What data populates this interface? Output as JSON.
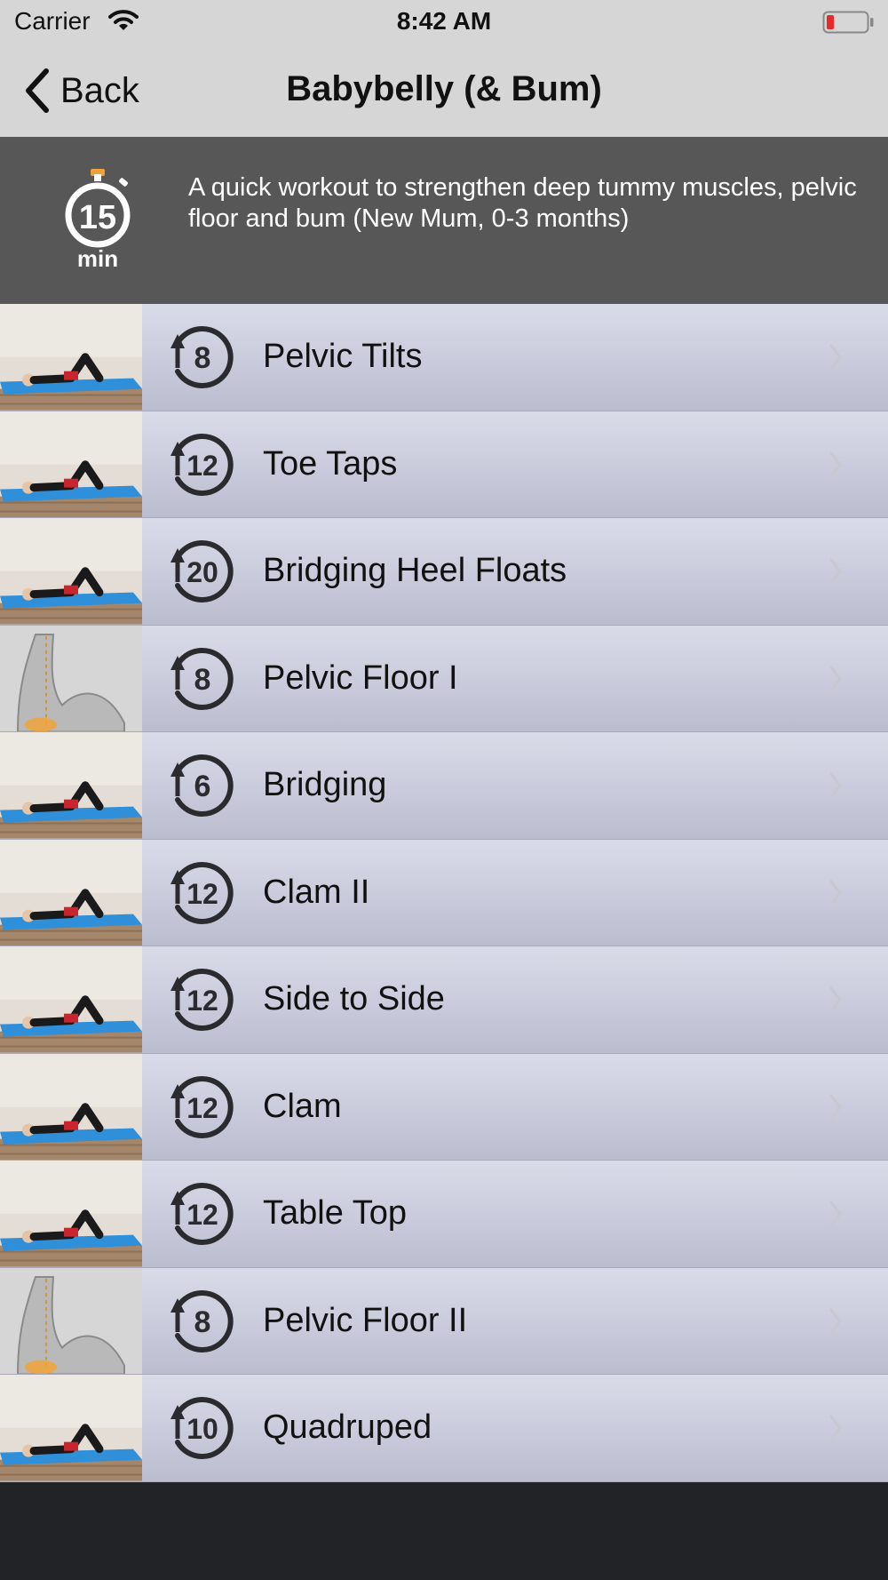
{
  "status_bar": {
    "carrier": "Carrier",
    "time": "8:42 AM",
    "battery_color": "#e8292a"
  },
  "nav": {
    "back_label": "Back",
    "title": "Babybelly (& Bum)"
  },
  "header": {
    "duration_number": "15",
    "duration_unit": "min",
    "description": "A quick workout to strengthen deep tummy muscles, pelvic floor and bum (New Mum, 0-3 months)",
    "accent_color": "#f0a23a"
  },
  "exercises": [
    {
      "name": "Pelvic Tilts",
      "reps": "8",
      "thumbnail": "photo"
    },
    {
      "name": "Toe Taps",
      "reps": "12",
      "thumbnail": "photo"
    },
    {
      "name": "Bridging Heel Floats",
      "reps": "20",
      "thumbnail": "photo"
    },
    {
      "name": "Pelvic Floor I",
      "reps": "8",
      "thumbnail": "diagram"
    },
    {
      "name": "Bridging",
      "reps": "6",
      "thumbnail": "photo"
    },
    {
      "name": "Clam II",
      "reps": "12",
      "thumbnail": "photo"
    },
    {
      "name": "Side to Side",
      "reps": "12",
      "thumbnail": "photo"
    },
    {
      "name": "Clam",
      "reps": "12",
      "thumbnail": "photo"
    },
    {
      "name": "Table Top",
      "reps": "12",
      "thumbnail": "photo"
    },
    {
      "name": "Pelvic Floor II",
      "reps": "8",
      "thumbnail": "diagram"
    },
    {
      "name": "Quadruped",
      "reps": "10",
      "thumbnail": "photo"
    }
  ],
  "icons": {
    "back": "chevron-left-icon",
    "wifi": "wifi-icon",
    "battery": "battery-icon",
    "timer": "stopwatch-icon",
    "reps": "repeat-counter-icon",
    "row_disclosure": "chevron-right-icon"
  }
}
